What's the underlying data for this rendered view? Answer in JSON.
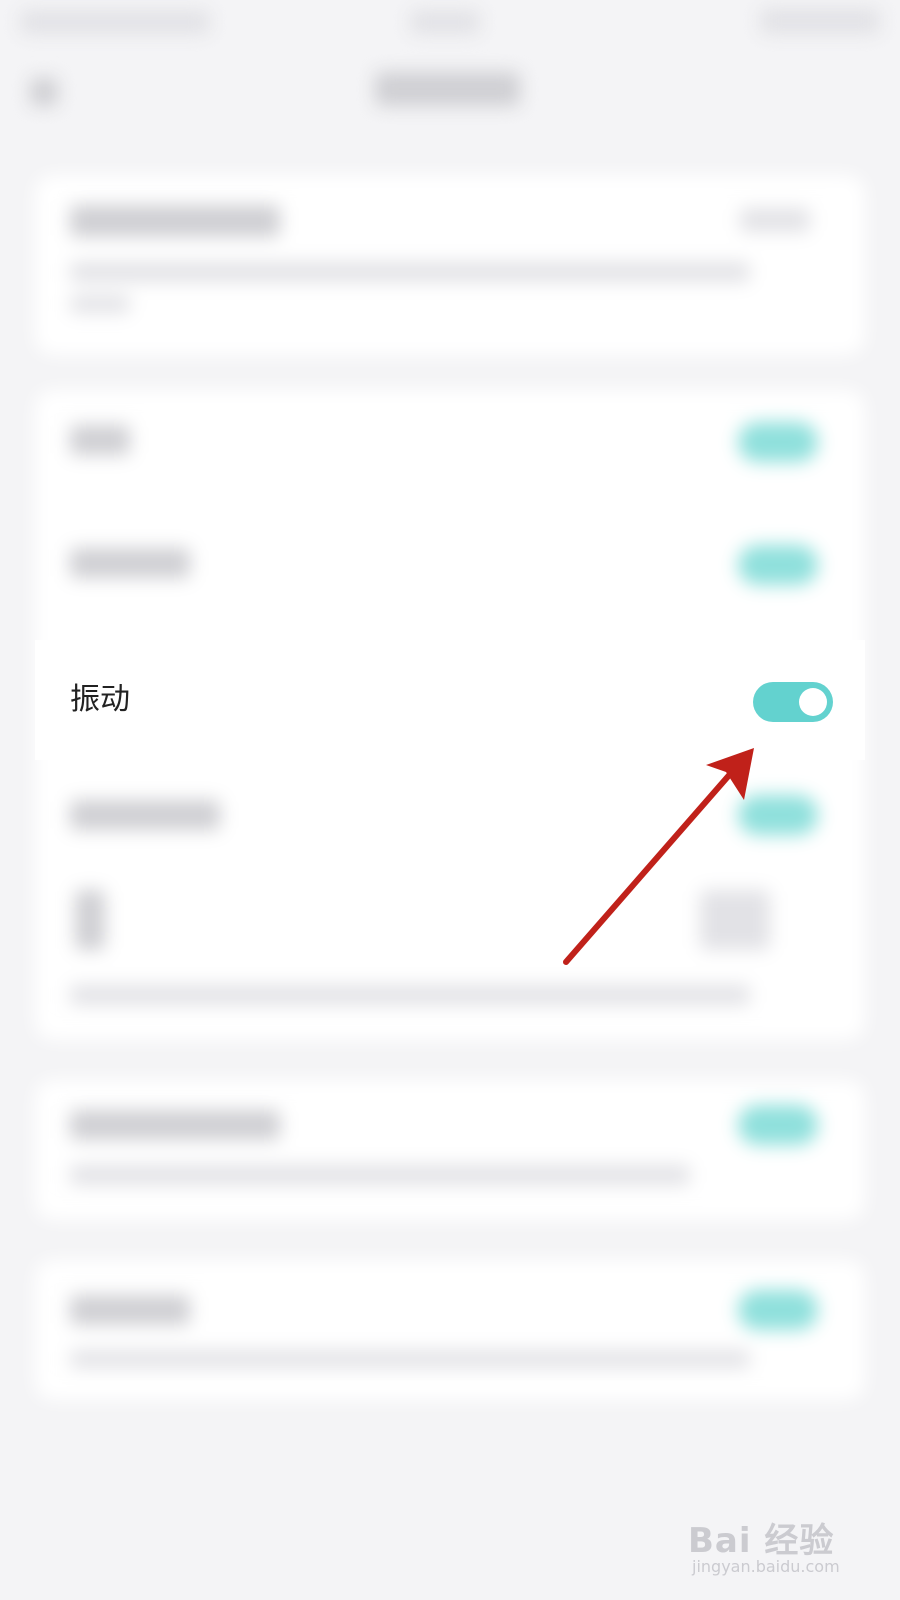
{
  "vibration_row": {
    "label": "振动",
    "toggle_on": true
  },
  "watermark": {
    "brand": "Bai 经验",
    "url": "jingyan.baidu.com"
  },
  "colors": {
    "background": "#f4f4f6",
    "toggle_on": "#63d2cf",
    "arrow": "#c0211a",
    "text": "#222222"
  }
}
